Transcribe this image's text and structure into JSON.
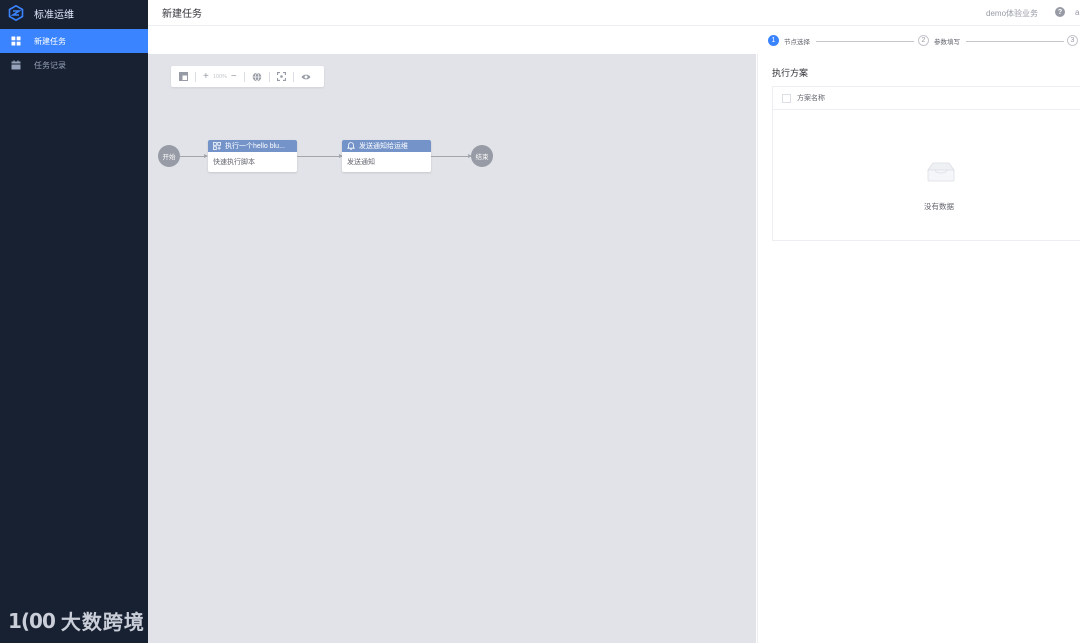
{
  "app": {
    "title": "标准运维"
  },
  "sidebar": {
    "items": [
      {
        "label": "新建任务",
        "icon": "grid-icon",
        "active": true
      },
      {
        "label": "任务记录",
        "icon": "calendar-icon",
        "active": false
      }
    ],
    "watermark": {
      "logo": "1(00",
      "text": "大数跨境"
    }
  },
  "header": {
    "title": "新建任务",
    "business": "demo体验业务",
    "help_icon": "?",
    "user_initial": "a"
  },
  "steps": [
    {
      "num": "1",
      "label": "节点选择",
      "active": true
    },
    {
      "num": "2",
      "label": "参数填写",
      "active": false
    },
    {
      "num": "3",
      "label": "",
      "active": false
    }
  ],
  "toolbar": {
    "zoom_value": "100%",
    "zoom_in": "+",
    "zoom_out": "−"
  },
  "flow": {
    "start_label": "开始",
    "end_label": "结束",
    "nodes": [
      {
        "title": "执行一个hello blu...",
        "subtitle": "快速执行脚本",
        "icon": "script-icon"
      },
      {
        "title": "发送通知给运维",
        "subtitle": "发送通知",
        "icon": "bell-icon"
      }
    ]
  },
  "panel": {
    "title": "执行方案",
    "column_header": "方案名称",
    "empty_text": "没有数据"
  },
  "colors": {
    "sidebar_bg": "#182132",
    "accent": "#3a84ff",
    "node_header": "#7393c9",
    "canvas_bg": "#e1e3e8"
  }
}
